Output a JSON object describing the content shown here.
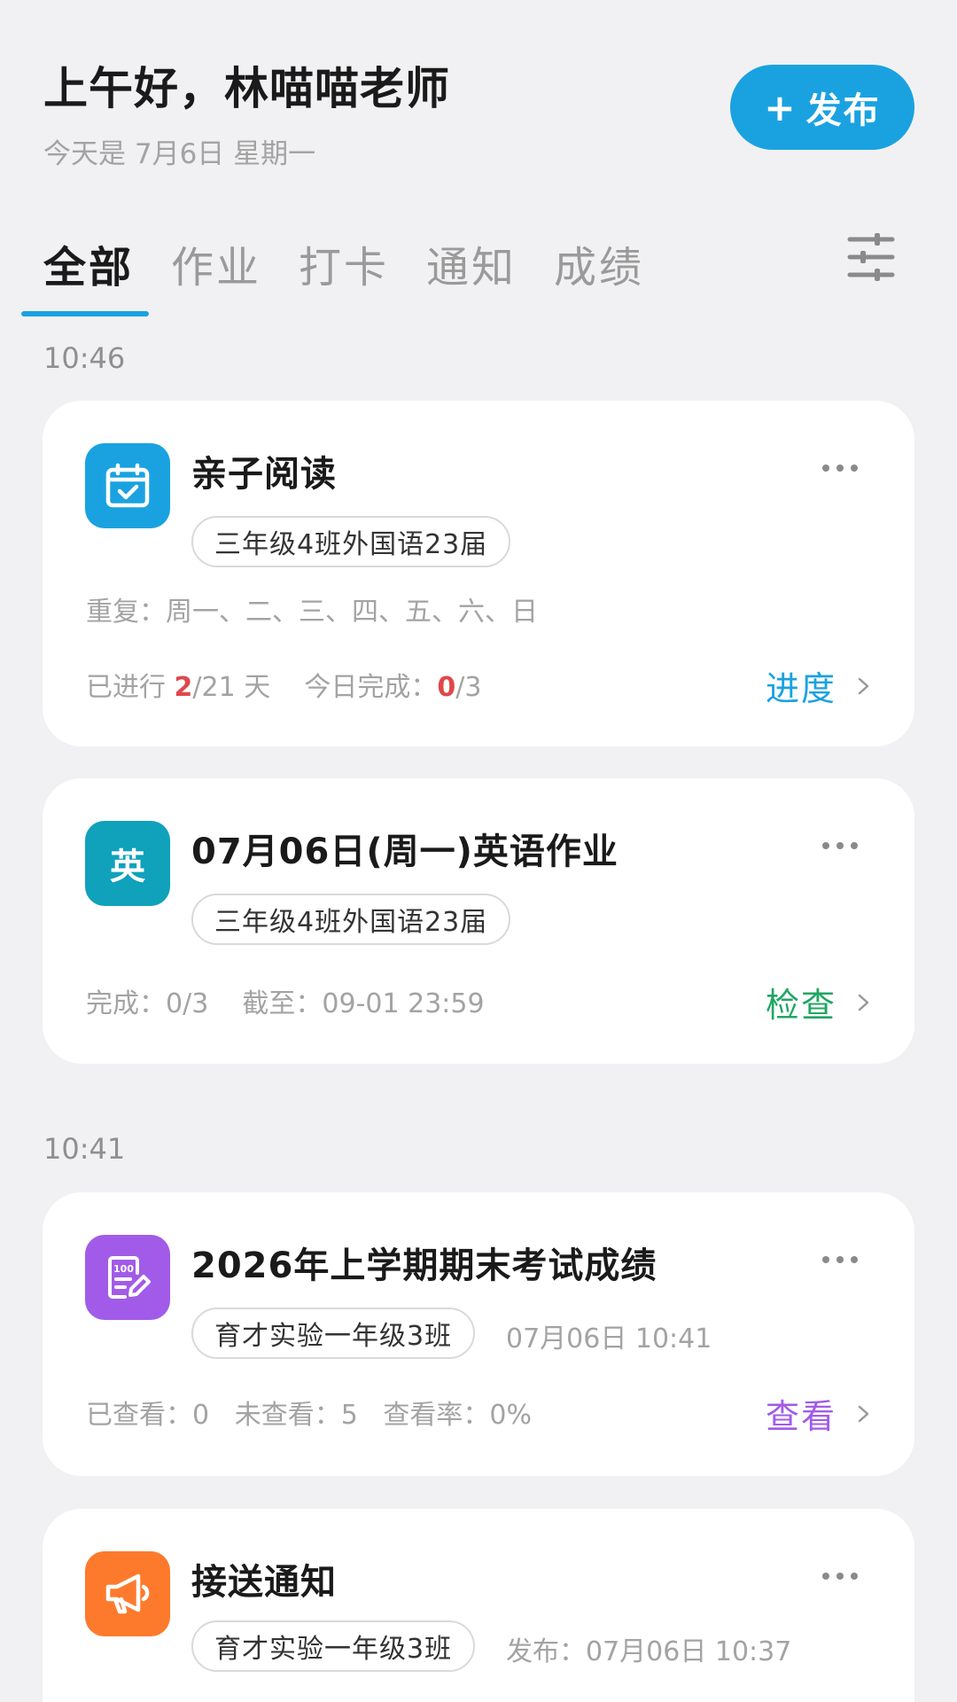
{
  "header": {
    "greeting": "上午好，林喵喵老师",
    "date": "今天是 7月6日 星期一",
    "publish_plus": "+",
    "publish_label": "发布"
  },
  "tabs": [
    {
      "label": "全部",
      "active": true
    },
    {
      "label": "作业",
      "active": false
    },
    {
      "label": "打卡",
      "active": false
    },
    {
      "label": "通知",
      "active": false
    },
    {
      "label": "成绩",
      "active": false
    }
  ],
  "groups": [
    {
      "time": "10:46"
    },
    {
      "time": "10:41"
    }
  ],
  "cards": [
    {
      "icon": "calendar-check-icon",
      "icon_color": "#1aa2e0",
      "title": "亲子阅读",
      "class_tag": "三年级4班外国语23届",
      "repeat": "重复：周一、二、三、四、五、六、日",
      "stat_prefix": "已进行 ",
      "stat_value1": "2",
      "stat_middle": "/21 天    今日完成：",
      "stat_value2": "0",
      "stat_suffix": "/3",
      "action": "进度",
      "action_color": "#1aa2e0"
    },
    {
      "icon": "english-badge-icon",
      "icon_text": "英",
      "icon_color": "#10a1bb",
      "title": "07月06日(周一)英语作业",
      "class_tag": "三年级4班外国语23届",
      "stats": "完成：0/3    截至：09-01 23:59",
      "action": "检查",
      "action_color": "#21a663"
    },
    {
      "icon": "score-sheet-icon",
      "icon_color": "#a25be8",
      "title": "2026年上学期期末考试成绩",
      "class_tag": "育才实验一年级3班",
      "timestamp": "07月06日 10:41",
      "stats": "已查看：0   未查看：5   查看率：0%",
      "action": "查看",
      "action_color": "#a25be8"
    },
    {
      "icon": "megaphone-icon",
      "icon_color": "#fd7a2c",
      "title": "接送通知",
      "class_tag": "育才实验一年级3班",
      "timestamp": "发布：07月06日 10:37"
    }
  ]
}
